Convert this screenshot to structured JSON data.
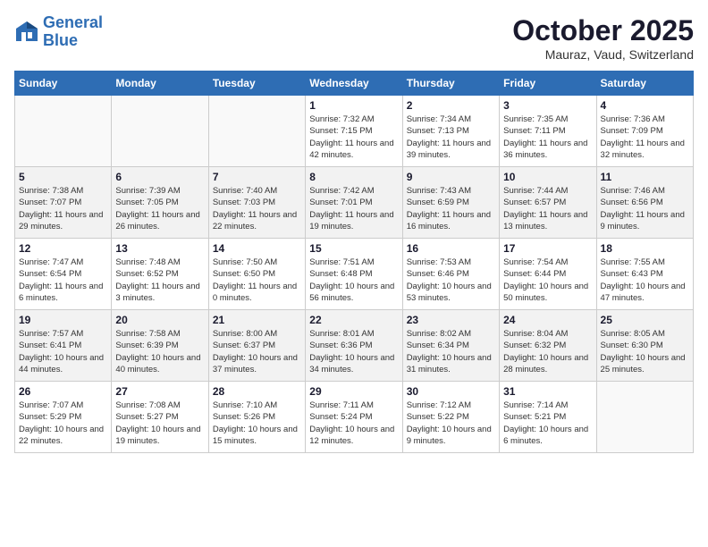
{
  "header": {
    "logo_line1": "General",
    "logo_line2": "Blue",
    "month": "October 2025",
    "location": "Mauraz, Vaud, Switzerland"
  },
  "weekdays": [
    "Sunday",
    "Monday",
    "Tuesday",
    "Wednesday",
    "Thursday",
    "Friday",
    "Saturday"
  ],
  "weeks": [
    [
      {
        "day": "",
        "info": ""
      },
      {
        "day": "",
        "info": ""
      },
      {
        "day": "",
        "info": ""
      },
      {
        "day": "1",
        "info": "Sunrise: 7:32 AM\nSunset: 7:15 PM\nDaylight: 11 hours\nand 42 minutes."
      },
      {
        "day": "2",
        "info": "Sunrise: 7:34 AM\nSunset: 7:13 PM\nDaylight: 11 hours\nand 39 minutes."
      },
      {
        "day": "3",
        "info": "Sunrise: 7:35 AM\nSunset: 7:11 PM\nDaylight: 11 hours\nand 36 minutes."
      },
      {
        "day": "4",
        "info": "Sunrise: 7:36 AM\nSunset: 7:09 PM\nDaylight: 11 hours\nand 32 minutes."
      }
    ],
    [
      {
        "day": "5",
        "info": "Sunrise: 7:38 AM\nSunset: 7:07 PM\nDaylight: 11 hours\nand 29 minutes."
      },
      {
        "day": "6",
        "info": "Sunrise: 7:39 AM\nSunset: 7:05 PM\nDaylight: 11 hours\nand 26 minutes."
      },
      {
        "day": "7",
        "info": "Sunrise: 7:40 AM\nSunset: 7:03 PM\nDaylight: 11 hours\nand 22 minutes."
      },
      {
        "day": "8",
        "info": "Sunrise: 7:42 AM\nSunset: 7:01 PM\nDaylight: 11 hours\nand 19 minutes."
      },
      {
        "day": "9",
        "info": "Sunrise: 7:43 AM\nSunset: 6:59 PM\nDaylight: 11 hours\nand 16 minutes."
      },
      {
        "day": "10",
        "info": "Sunrise: 7:44 AM\nSunset: 6:57 PM\nDaylight: 11 hours\nand 13 minutes."
      },
      {
        "day": "11",
        "info": "Sunrise: 7:46 AM\nSunset: 6:56 PM\nDaylight: 11 hours\nand 9 minutes."
      }
    ],
    [
      {
        "day": "12",
        "info": "Sunrise: 7:47 AM\nSunset: 6:54 PM\nDaylight: 11 hours\nand 6 minutes."
      },
      {
        "day": "13",
        "info": "Sunrise: 7:48 AM\nSunset: 6:52 PM\nDaylight: 11 hours\nand 3 minutes."
      },
      {
        "day": "14",
        "info": "Sunrise: 7:50 AM\nSunset: 6:50 PM\nDaylight: 11 hours\nand 0 minutes."
      },
      {
        "day": "15",
        "info": "Sunrise: 7:51 AM\nSunset: 6:48 PM\nDaylight: 10 hours\nand 56 minutes."
      },
      {
        "day": "16",
        "info": "Sunrise: 7:53 AM\nSunset: 6:46 PM\nDaylight: 10 hours\nand 53 minutes."
      },
      {
        "day": "17",
        "info": "Sunrise: 7:54 AM\nSunset: 6:44 PM\nDaylight: 10 hours\nand 50 minutes."
      },
      {
        "day": "18",
        "info": "Sunrise: 7:55 AM\nSunset: 6:43 PM\nDaylight: 10 hours\nand 47 minutes."
      }
    ],
    [
      {
        "day": "19",
        "info": "Sunrise: 7:57 AM\nSunset: 6:41 PM\nDaylight: 10 hours\nand 44 minutes."
      },
      {
        "day": "20",
        "info": "Sunrise: 7:58 AM\nSunset: 6:39 PM\nDaylight: 10 hours\nand 40 minutes."
      },
      {
        "day": "21",
        "info": "Sunrise: 8:00 AM\nSunset: 6:37 PM\nDaylight: 10 hours\nand 37 minutes."
      },
      {
        "day": "22",
        "info": "Sunrise: 8:01 AM\nSunset: 6:36 PM\nDaylight: 10 hours\nand 34 minutes."
      },
      {
        "day": "23",
        "info": "Sunrise: 8:02 AM\nSunset: 6:34 PM\nDaylight: 10 hours\nand 31 minutes."
      },
      {
        "day": "24",
        "info": "Sunrise: 8:04 AM\nSunset: 6:32 PM\nDaylight: 10 hours\nand 28 minutes."
      },
      {
        "day": "25",
        "info": "Sunrise: 8:05 AM\nSunset: 6:30 PM\nDaylight: 10 hours\nand 25 minutes."
      }
    ],
    [
      {
        "day": "26",
        "info": "Sunrise: 7:07 AM\nSunset: 5:29 PM\nDaylight: 10 hours\nand 22 minutes."
      },
      {
        "day": "27",
        "info": "Sunrise: 7:08 AM\nSunset: 5:27 PM\nDaylight: 10 hours\nand 19 minutes."
      },
      {
        "day": "28",
        "info": "Sunrise: 7:10 AM\nSunset: 5:26 PM\nDaylight: 10 hours\nand 15 minutes."
      },
      {
        "day": "29",
        "info": "Sunrise: 7:11 AM\nSunset: 5:24 PM\nDaylight: 10 hours\nand 12 minutes."
      },
      {
        "day": "30",
        "info": "Sunrise: 7:12 AM\nSunset: 5:22 PM\nDaylight: 10 hours\nand 9 minutes."
      },
      {
        "day": "31",
        "info": "Sunrise: 7:14 AM\nSunset: 5:21 PM\nDaylight: 10 hours\nand 6 minutes."
      },
      {
        "day": "",
        "info": ""
      }
    ]
  ]
}
